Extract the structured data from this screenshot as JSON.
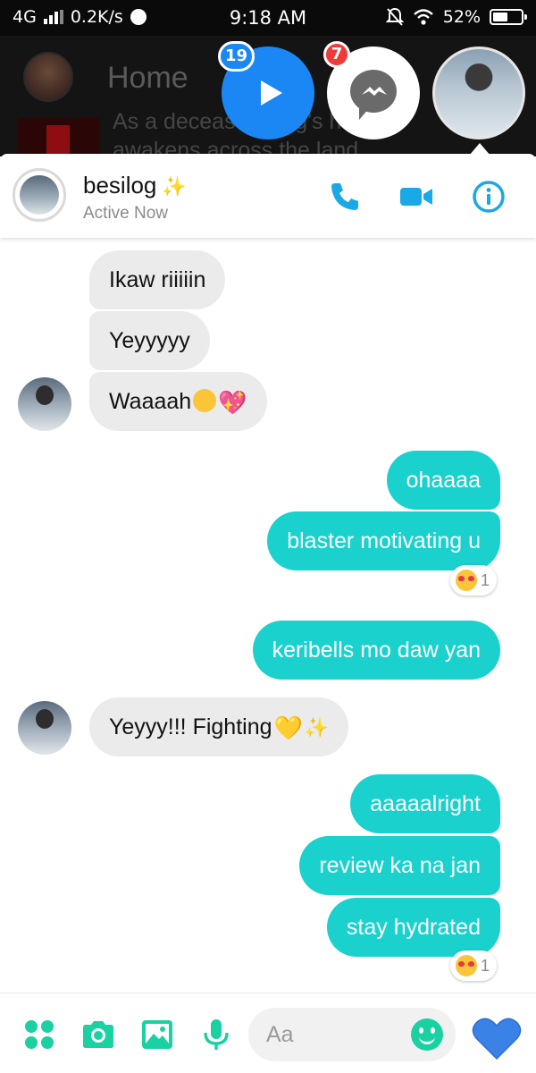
{
  "status_bar": {
    "network": "4G",
    "speed": "0.2K/s",
    "time": "9:18 AM",
    "battery": "52%",
    "battery_level": 0.52
  },
  "background_app": {
    "title": "Home",
    "description": "As a deceased king's hunger awakens across the land"
  },
  "chat_heads": {
    "play_badge": "19",
    "messenger_badge": "7"
  },
  "chat": {
    "name": "besilog",
    "name_emoji": "✨",
    "status": "Active Now"
  },
  "messages": [
    {
      "direction": "in",
      "text": "Ikaw riiiiin"
    },
    {
      "direction": "in",
      "text": "Yeyyyyy"
    },
    {
      "direction": "in",
      "text": "Waaaah",
      "emojis": [
        "tired-face",
        "sparkling-heart"
      ]
    },
    {
      "direction": "out",
      "text": "ohaaaa"
    },
    {
      "direction": "out",
      "text": "blaster motivating u",
      "reaction": {
        "emoji": "heart-eyes",
        "count": "1"
      }
    },
    {
      "direction": "out",
      "text": "keribells mo daw yan"
    },
    {
      "direction": "in",
      "text": "Yeyyy!!! Fighting",
      "emojis": [
        "yellow-heart",
        "sparkles"
      ]
    },
    {
      "direction": "out",
      "text": "aaaaalright"
    },
    {
      "direction": "out",
      "text": "review ka na jan"
    },
    {
      "direction": "out",
      "text": "stay hydrated",
      "reaction": {
        "emoji": "heart-eyes",
        "count": "1"
      }
    }
  ],
  "composer": {
    "placeholder": "Aa"
  },
  "colors": {
    "accent": "#1ad1cd",
    "messenger_blue": "#1b87f5",
    "header_icons": "#1ba8e6",
    "like_heart": "#3b82e6"
  }
}
